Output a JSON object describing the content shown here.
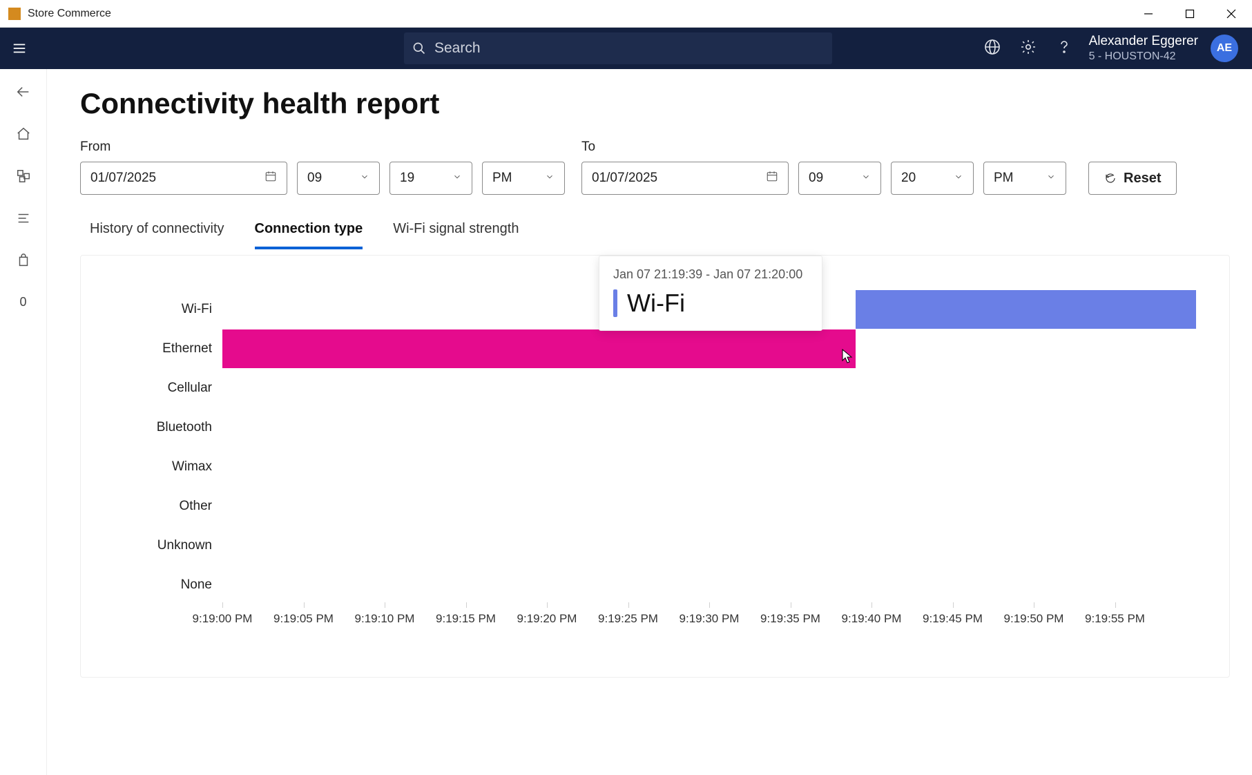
{
  "app": {
    "title": "Store Commerce"
  },
  "header": {
    "search_placeholder": "Search",
    "user_name": "Alexander Eggerer",
    "user_sub": "5 - HOUSTON-42",
    "avatar_initials": "AE"
  },
  "sidebar": {
    "zero": "0"
  },
  "page": {
    "title": "Connectivity health report",
    "from_label": "From",
    "to_label": "To",
    "from_date": "01/07/2025",
    "from_hour": "09",
    "from_min": "19",
    "from_ampm": "PM",
    "to_date": "01/07/2025",
    "to_hour": "09",
    "to_min": "20",
    "to_ampm": "PM",
    "reset_label": "Reset",
    "tabs": [
      {
        "label": "History of connectivity"
      },
      {
        "label": "Connection type"
      },
      {
        "label": "Wi-Fi signal strength"
      }
    ],
    "tooltip_time": "Jan 07 21:19:39 - Jan 07 21:20:00",
    "tooltip_name": "Wi-Fi"
  },
  "chart_data": {
    "type": "bar",
    "orientation": "horizontal_timeline",
    "x_start_seconds": 0,
    "x_end_seconds": 60,
    "x_tick_interval_seconds": 5,
    "x_tick_labels": [
      "9:19:00 PM",
      "9:19:05 PM",
      "9:19:10 PM",
      "9:19:15 PM",
      "9:19:20 PM",
      "9:19:25 PM",
      "9:19:30 PM",
      "9:19:35 PM",
      "9:19:40 PM",
      "9:19:45 PM",
      "9:19:50 PM",
      "9:19:55 PM"
    ],
    "y_categories": [
      "Wi-Fi",
      "Ethernet",
      "Cellular",
      "Bluetooth",
      "Wimax",
      "Other",
      "Unknown",
      "None"
    ],
    "series": [
      {
        "name": "Wi-Fi",
        "color": "#6a7fe6",
        "segments": [
          {
            "start_s": 39,
            "end_s": 60
          }
        ]
      },
      {
        "name": "Ethernet",
        "color": "#e50b8d",
        "segments": [
          {
            "start_s": 0,
            "end_s": 39
          }
        ]
      },
      {
        "name": "Cellular",
        "color": "#888",
        "segments": []
      },
      {
        "name": "Bluetooth",
        "color": "#888",
        "segments": []
      },
      {
        "name": "Wimax",
        "color": "#888",
        "segments": []
      },
      {
        "name": "Other",
        "color": "#888",
        "segments": []
      },
      {
        "name": "Unknown",
        "color": "#888",
        "segments": []
      },
      {
        "name": "None",
        "color": "#888",
        "segments": []
      }
    ],
    "title": "",
    "xlabel": "",
    "ylabel": ""
  }
}
